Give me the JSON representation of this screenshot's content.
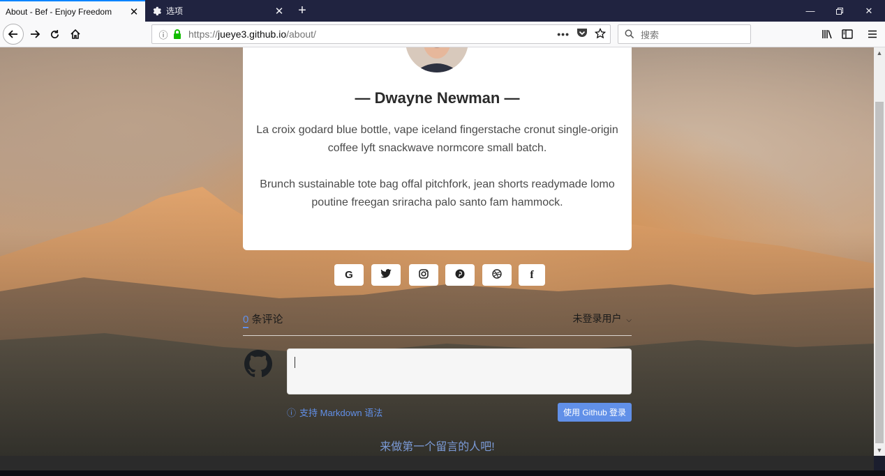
{
  "browser": {
    "tabs": [
      {
        "title": "About - Bef - Enjoy Freedom",
        "active": true
      },
      {
        "title": "选项",
        "active": false
      }
    ],
    "url": {
      "scheme": "https://",
      "host": "jueye3.github.io",
      "path": "/about/"
    },
    "search_placeholder": "搜索"
  },
  "profile": {
    "name": "— Dwayne Newman —",
    "bio_p1": "La croix godard blue bottle, vape iceland fingerstache cronut single-origin coffee lyft snackwave normcore small batch.",
    "bio_p2": "Brunch sustainable tote bag offal pitchfork, jean shorts readymade lomo poutine freegan sriracha palo santo fam hammock."
  },
  "social": [
    {
      "name": "google-icon",
      "glyph": "G"
    },
    {
      "name": "twitter-icon",
      "glyph": ""
    },
    {
      "name": "instagram-icon",
      "glyph": ""
    },
    {
      "name": "pinterest-icon",
      "glyph": ""
    },
    {
      "name": "dribbble-icon",
      "glyph": ""
    },
    {
      "name": "facebook-icon",
      "glyph": "f"
    }
  ],
  "comments": {
    "count": "0",
    "count_label": " 条评论",
    "user_menu": "未登录用户",
    "markdown_tip": "支持 Markdown 语法",
    "login_button": "使用 Github 登录",
    "empty_message": "来做第一个留言的人吧!"
  },
  "colors": {
    "accent": "#6190e8",
    "tabstrip": "#202340"
  }
}
